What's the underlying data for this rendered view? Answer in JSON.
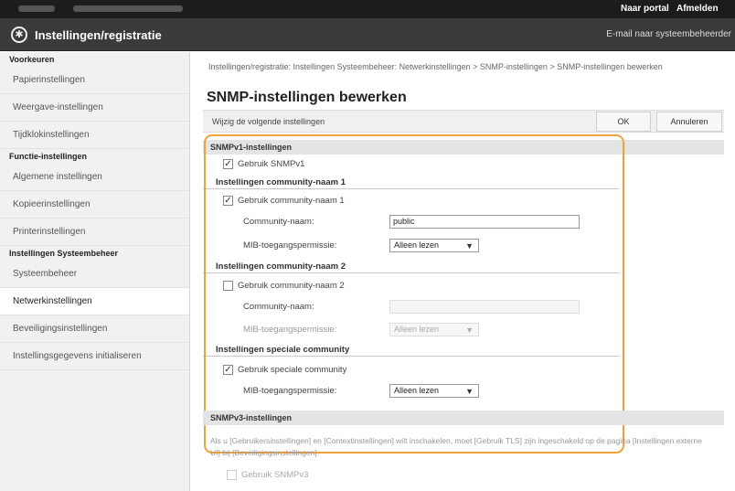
{
  "topbar": {
    "portal_link": "Naar portal",
    "logout_link": "Afmelden"
  },
  "header": {
    "title": "Instellingen/registratie",
    "mail_link": "E-mail naar systeembeheerder",
    "logo_icon": "gear-wrench-icon"
  },
  "sidebar": {
    "groups": [
      {
        "heading": "Voorkeuren",
        "items": [
          "Papierinstellingen",
          "Weergave-instellingen",
          "Tijdklokinstellingen"
        ]
      },
      {
        "heading": "Functie-instellingen",
        "items": [
          "Algemene instellingen",
          "Kopieerinstellingen",
          "Printerinstellingen"
        ]
      },
      {
        "heading": "Instellingen Systeembeheer",
        "items": [
          "Systeembeheer",
          "Netwerkinstellingen",
          "Beveiligingsinstellingen",
          "Instellingsgegevens initialiseren"
        ]
      }
    ],
    "active_item": "Netwerkinstellingen"
  },
  "main": {
    "breadcrumb": "Instellingen/registratie: Instellingen Systeembeheer: Netwerkinstellingen > SNMP-instellingen > SNMP-instellingen bewerken",
    "page_title": "SNMP-instellingen bewerken",
    "toolbar_label": "Wijzig de volgende instellingen",
    "ok_label": "OK",
    "cancel_label": "Annuleren",
    "snmpv1": {
      "section_title": "SNMPv1-instellingen",
      "use_snmpv1_label": "Gebruik SNMPv1",
      "use_snmpv1_checked": true,
      "community1": {
        "heading": "Instellingen community-naam 1",
        "use_label": "Gebruik community-naam 1",
        "use_checked": true,
        "name_label": "Community-naam:",
        "name_value": "public",
        "perm_label": "MIB-toegangspermissie:",
        "perm_value": "Alleen lezen"
      },
      "community2": {
        "heading": "Instellingen community-naam 2",
        "use_label": "Gebruik community-naam 2",
        "use_checked": false,
        "name_label": "Community-naam:",
        "name_value": "",
        "perm_label": "MIB-toegangspermissie:",
        "perm_value": "Alleen lezen"
      },
      "special": {
        "heading": "Instellingen speciale community",
        "use_label": "Gebruik speciale community",
        "use_checked": true,
        "perm_label": "MIB-toegangspermissie:",
        "perm_value": "Alleen lezen"
      }
    },
    "snmpv3": {
      "section_title": "SNMPv3-instellingen",
      "note": "Als u [Gebruikersinstellingen] en [Contextinstellingen] wilt inschakelen, moet [Gebruik TLS] zijn ingeschakeld op de pagina [Instellingen externe UI] bij [Beveiligingsinstellingen].",
      "use_label": "Gebruik SNMPv3",
      "use_checked": false
    }
  },
  "colors": {
    "highlight_border": "#f0a23a",
    "header_bg": "#3a3a3a",
    "topbar_bg": "#1c1c1c"
  }
}
